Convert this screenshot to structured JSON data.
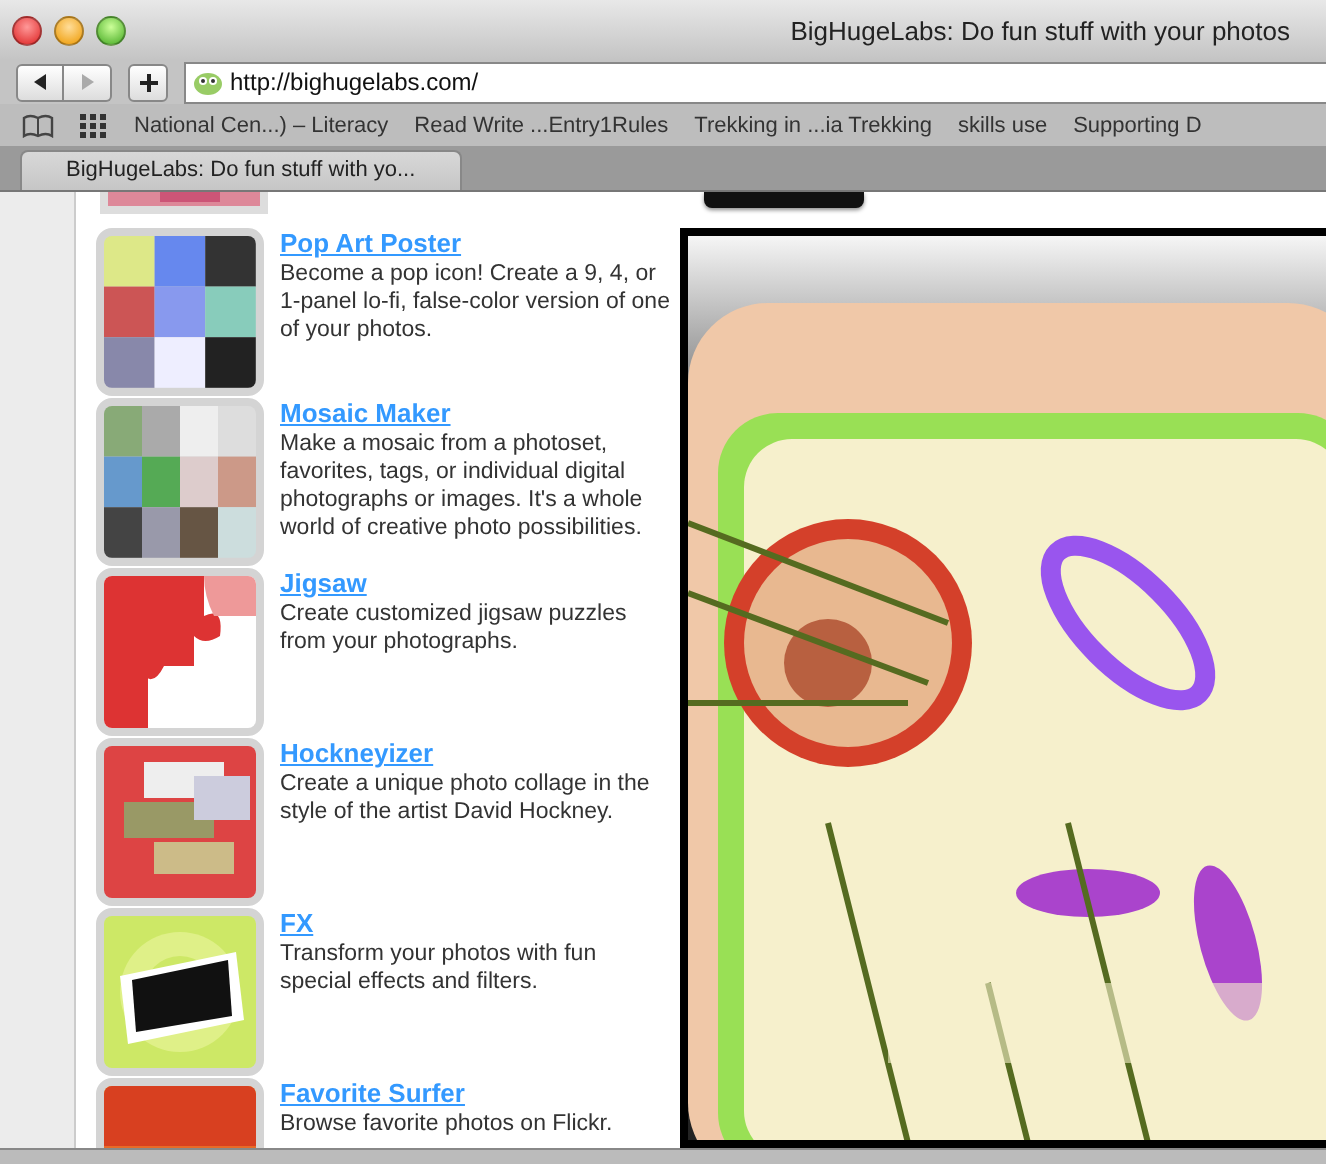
{
  "window": {
    "title": "BigHugeLabs: Do fun stuff with your photos"
  },
  "toolbar": {
    "url": "http://bighugelabs.com/"
  },
  "bookmarks": [
    "National Cen...) – Literacy",
    "Read Write ...Entry1Rules",
    "Trekking in ...ia Trekking",
    "skills use",
    "Supporting D"
  ],
  "tabs": [
    {
      "label": "BigHugeLabs: Do fun stuff with yo...",
      "selected": true
    }
  ],
  "tools": [
    {
      "title": "Pop Art Poster",
      "description": "Become a pop icon! Create a 9, 4, or 1-panel lo-fi, false-color version of one of your photos."
    },
    {
      "title": "Mosaic Maker",
      "description": "Make a mosaic from a photoset, favorites, tags, or individual digital photographs or images. It's a whole world of creative photo possibilities."
    },
    {
      "title": "Jigsaw",
      "description": "Create customized jigsaw puzzles from your photographs."
    },
    {
      "title": "Hockneyizer",
      "description": "Create a unique photo collage in the style of the artist David Hockney."
    },
    {
      "title": "FX",
      "description": "Transform your photos with fun special effects and filters."
    },
    {
      "title": "Favorite Surfer",
      "description": "Browse favorite photos on Flickr."
    }
  ],
  "poster": {
    "kind": "picture"
  }
}
